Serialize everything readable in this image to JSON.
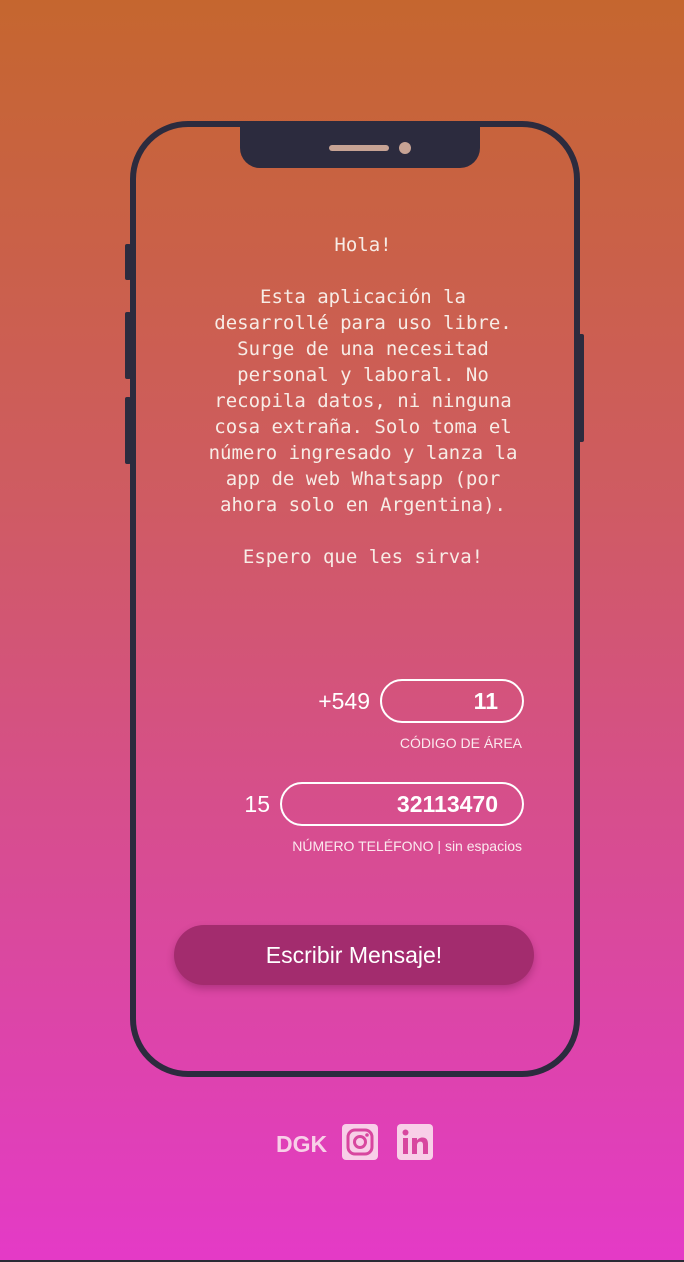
{
  "message": {
    "greeting": "Hola!",
    "body_lines": [
      "Esta aplicación la",
      "desarrollé para uso libre.",
      "Surge de una necesitad",
      "personal y laboral. No",
      "recopila datos, ni ninguna",
      "cosa extraña. Solo toma el",
      "número ingresado y lanza la",
      "app de web Whatsapp (por",
      "ahora solo en Argentina)."
    ],
    "closing": "Espero que les sirva!"
  },
  "area_code": {
    "prefix": "+549",
    "value": "11",
    "hint": "CÓDIGO DE ÁREA"
  },
  "phone_number": {
    "prefix": "15",
    "value": "32113470",
    "hint": "NÚMERO TELÉFONO | sin espacios"
  },
  "actions": {
    "send_label": "Escribir Mensaje!"
  },
  "footer": {
    "brand": "DGK",
    "icons": [
      "instagram-icon",
      "linkedin-icon"
    ]
  },
  "colors": {
    "gradient_top": "#c5662f",
    "gradient_bottom": "#e43ac7",
    "phone_frame": "#2c2b3e",
    "button": "#a32c6e",
    "footer_icon": "#f8cfe8"
  }
}
